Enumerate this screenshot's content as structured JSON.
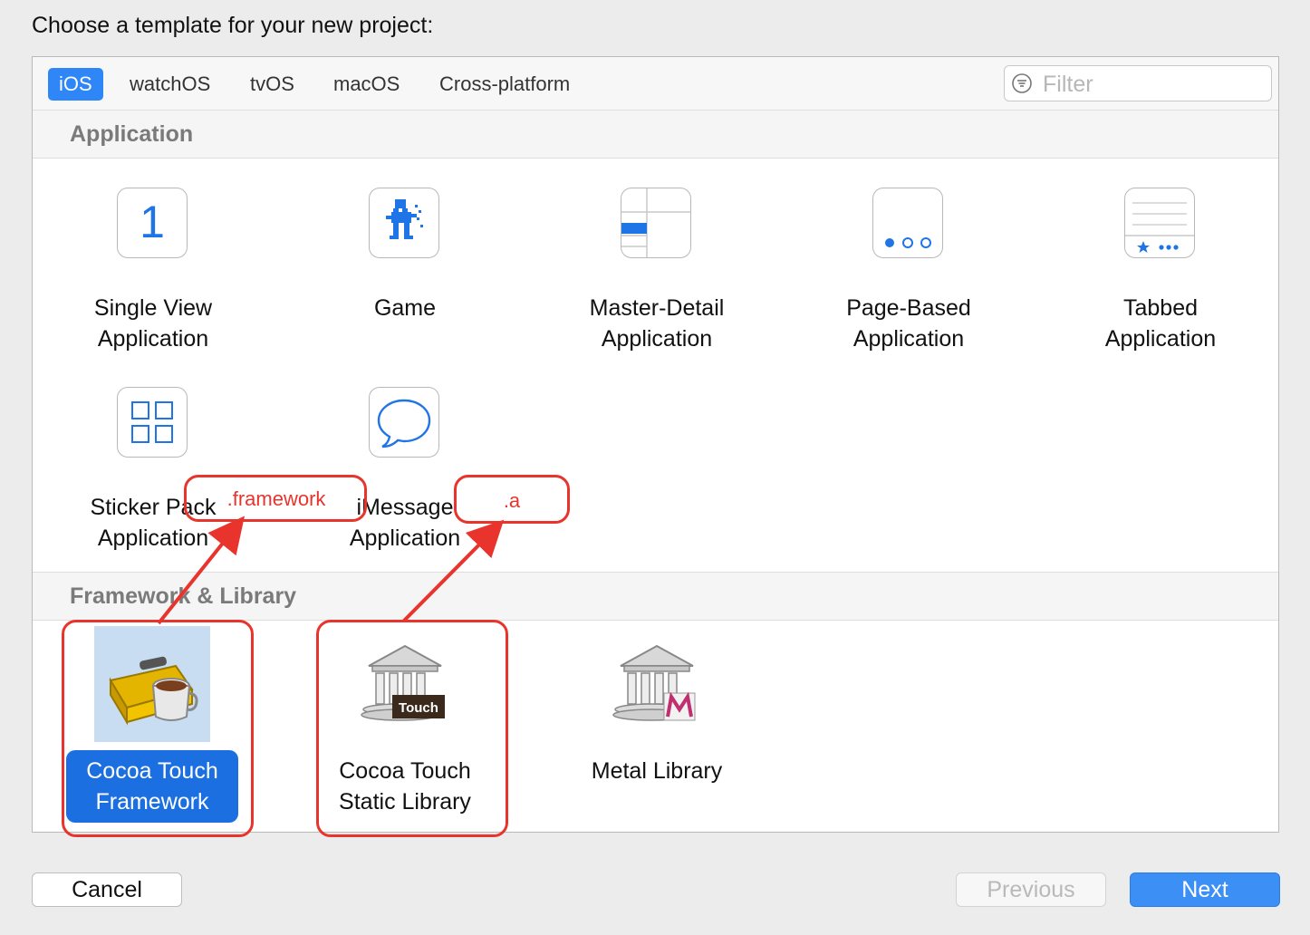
{
  "heading": "Choose a template for your new project:",
  "tabs": [
    {
      "label": "iOS",
      "active": true
    },
    {
      "label": "watchOS"
    },
    {
      "label": "tvOS"
    },
    {
      "label": "macOS"
    },
    {
      "label": "Cross-platform"
    }
  ],
  "filter": {
    "placeholder": "Filter",
    "value": ""
  },
  "sections": {
    "application": {
      "title": "Application",
      "items": [
        {
          "label_line1": "Single View",
          "label_line2": "Application",
          "icon": "single-view-icon"
        },
        {
          "label_line1": "Game",
          "label_line2": "",
          "icon": "game-icon"
        },
        {
          "label_line1": "Master-Detail",
          "label_line2": "Application",
          "icon": "master-detail-icon"
        },
        {
          "label_line1": "Page-Based",
          "label_line2": "Application",
          "icon": "page-based-icon"
        },
        {
          "label_line1": "Tabbed",
          "label_line2": "Application",
          "icon": "tabbed-icon"
        },
        {
          "label_line1": "Sticker Pack",
          "label_line2": "Application",
          "icon": "sticker-pack-icon"
        },
        {
          "label_line1": "iMessage",
          "label_line2": "Application",
          "icon": "imessage-icon"
        }
      ]
    },
    "framework": {
      "title": "Framework & Library",
      "items": [
        {
          "label_line1": "Cocoa Touch",
          "label_line2": "Framework",
          "icon": "cocoa-toolbox-icon",
          "selected": true
        },
        {
          "label_line1": "Cocoa Touch",
          "label_line2": "Static Library",
          "icon": "static-library-icon",
          "badge": "Touch"
        },
        {
          "label_line1": "Metal Library",
          "label_line2": "",
          "icon": "metal-library-icon"
        }
      ]
    }
  },
  "icon_glyphs": {
    "single_view": "1"
  },
  "annotations": {
    "framework": ".framework",
    "static": ".a"
  },
  "buttons": {
    "cancel": "Cancel",
    "previous": "Previous",
    "next": "Next"
  },
  "colors": {
    "accent": "#2f86f6",
    "selection": "#1b6fe0",
    "annotation": "#e8342c"
  }
}
